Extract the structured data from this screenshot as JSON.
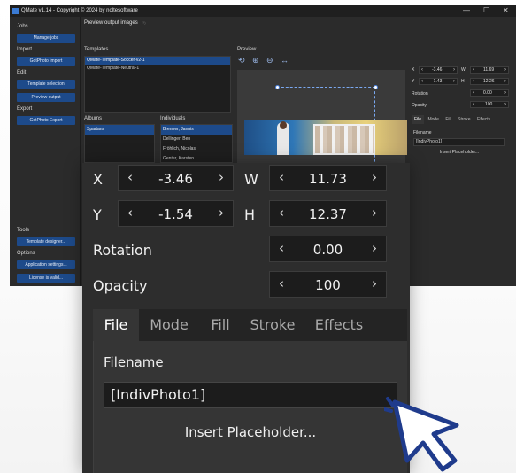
{
  "window": {
    "title": "QMate v1.14 - Copyright © 2024 by noltesoftware",
    "controls": [
      "—",
      "☐",
      "✕"
    ]
  },
  "sidebar": {
    "sections": [
      {
        "heading": "Jobs",
        "buttons": [
          "Manage jobs"
        ]
      },
      {
        "heading": "Import",
        "buttons": [
          "GotPhoto Import"
        ]
      },
      {
        "heading": "Edit",
        "buttons": [
          "Template selection",
          "Preview output"
        ]
      },
      {
        "heading": "Export",
        "buttons": [
          "GotPhoto Export"
        ]
      },
      {
        "heading": "Tools",
        "buttons": [
          "Template designer..."
        ]
      },
      {
        "heading": "Options",
        "buttons": [
          "Application settings...",
          "License is valid..."
        ]
      }
    ]
  },
  "main": {
    "header": "Preview output images",
    "header_help": "(?)",
    "templates_label": "Templates",
    "templates": [
      "QMate-Template-Soccer-v2-1",
      "QMate-Template-Neutral-1"
    ],
    "templates_selected": 0,
    "preview_label": "Preview",
    "zoom_tools": [
      "zoom-fit-icon",
      "zoom-in-icon",
      "zoom-out-icon",
      "fit-width-icon"
    ],
    "albums_label": "Albums",
    "albums": [
      "Spartans"
    ],
    "individuals_label": "Individuals",
    "individuals": [
      "Brenner, Jannis",
      "Dellinger, Ben",
      "Fröhlich, Nicolas",
      "Genter, Karsten"
    ],
    "individuals_selected": 0
  },
  "mini_props": {
    "x": "-3.46",
    "y": "-1.43",
    "w": "11.69",
    "h": "12.26",
    "rotation": "0.00",
    "opacity": "100",
    "tabs": [
      "File",
      "Mode",
      "Fill",
      "Stroke",
      "Effects"
    ],
    "filename_label": "Filename",
    "filename": "[IndivPhoto1]",
    "insert_label": "Insert Placeholder..."
  },
  "callout": {
    "x_label": "X",
    "x_value": "-3.46",
    "w_label": "W",
    "w_value": "11.73",
    "y_label": "Y",
    "y_value": "-1.54",
    "h_label": "H",
    "h_value": "12.37",
    "rotation_label": "Rotation",
    "rotation_value": "0.00",
    "opacity_label": "Opacity",
    "opacity_value": "100",
    "tabs": [
      "File",
      "Mode",
      "Fill",
      "Stroke",
      "Effects"
    ],
    "active_tab": "File",
    "filename_label": "Filename",
    "filename_value": "[IndivPhoto1]",
    "insert_button": "Insert Placeholder..."
  },
  "colors": {
    "accent": "#1d4a8a",
    "panel": "#2d2d2d",
    "field": "#1c1c1c"
  },
  "arrows": {
    "left": "‹",
    "right": "›"
  }
}
